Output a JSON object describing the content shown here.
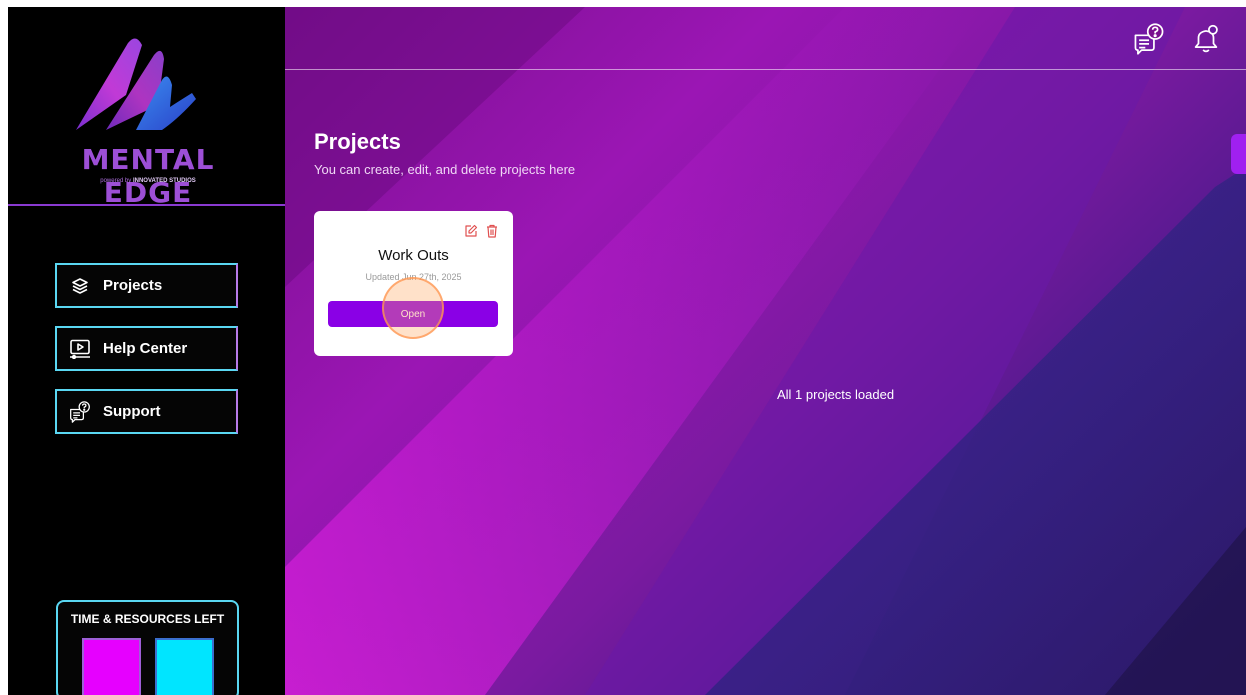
{
  "brand": {
    "title": "MENTAL EDGE",
    "subtitle_prefix": "powered by",
    "subtitle_company": "INNOVATED STUDIOS"
  },
  "sidebar": {
    "items": [
      {
        "label": "Projects",
        "icon": "layers-icon"
      },
      {
        "label": "Help Center",
        "icon": "video-play-icon"
      },
      {
        "label": "Support",
        "icon": "chat-question-icon"
      }
    ],
    "resources": {
      "title": "TIME & RESOURCES LEFT",
      "colors": [
        "#e600ff",
        "#00e5ff"
      ]
    }
  },
  "header": {
    "icons": [
      "chat-question-icon",
      "bell-icon"
    ]
  },
  "main": {
    "title": "Projects",
    "subtitle": "You can create, edit, and delete projects here",
    "projects": [
      {
        "name": "Work Outs",
        "updated": "Updated Jun 27th, 2025",
        "open_label": "Open"
      }
    ],
    "status": "All 1 projects loaded"
  },
  "colors": {
    "accent": "#8a00e6",
    "sidebar_border": "#5ad7f2",
    "delete": "#e05050"
  }
}
